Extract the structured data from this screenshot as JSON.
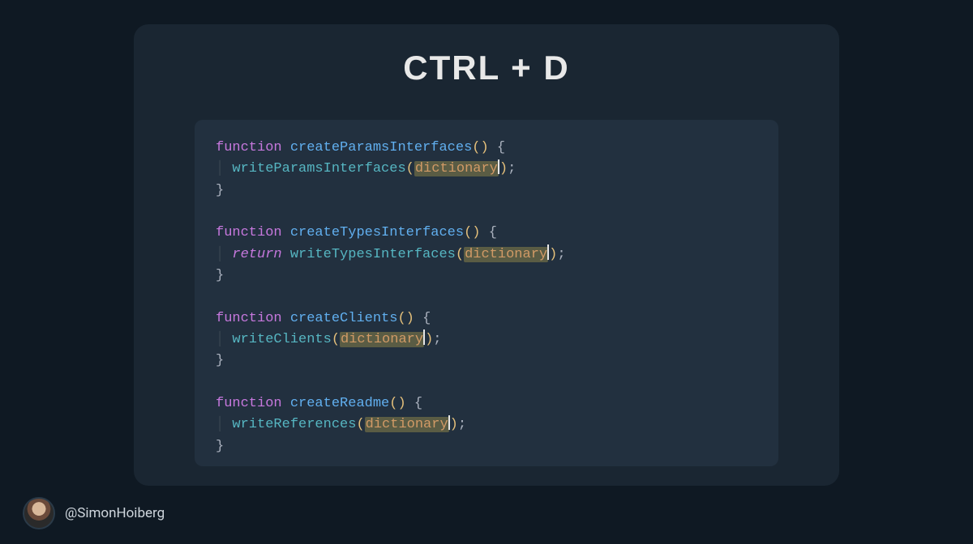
{
  "title": "CTRL + D",
  "handle": "@SimonHoiberg",
  "syntax": {
    "keyword_function": "function",
    "keyword_return": "return",
    "selected_word": "dictionary"
  },
  "code": {
    "blocks": [
      {
        "declare": "createParamsInterfaces",
        "call": "writeParamsInterfaces",
        "has_return": false,
        "arg_selected": true
      },
      {
        "declare": "createTypesInterfaces",
        "call": "writeTypesInterfaces",
        "has_return": true,
        "arg_selected": true
      },
      {
        "declare": "createClients",
        "call": "writeClients",
        "has_return": false,
        "arg_selected": true
      },
      {
        "declare": "createReadme",
        "call": "writeReferences",
        "has_return": false,
        "arg_selected": true
      }
    ]
  },
  "colors": {
    "page_bg": "#0f1923",
    "card_bg": "#1a2632",
    "code_bg": "#22303f",
    "selection_bg": "#5a5c44",
    "keyword": "#c678dd",
    "function_name": "#61afef",
    "call_name": "#56b6c2",
    "paren": "#e5c07b",
    "identifier": "#d19a66"
  }
}
